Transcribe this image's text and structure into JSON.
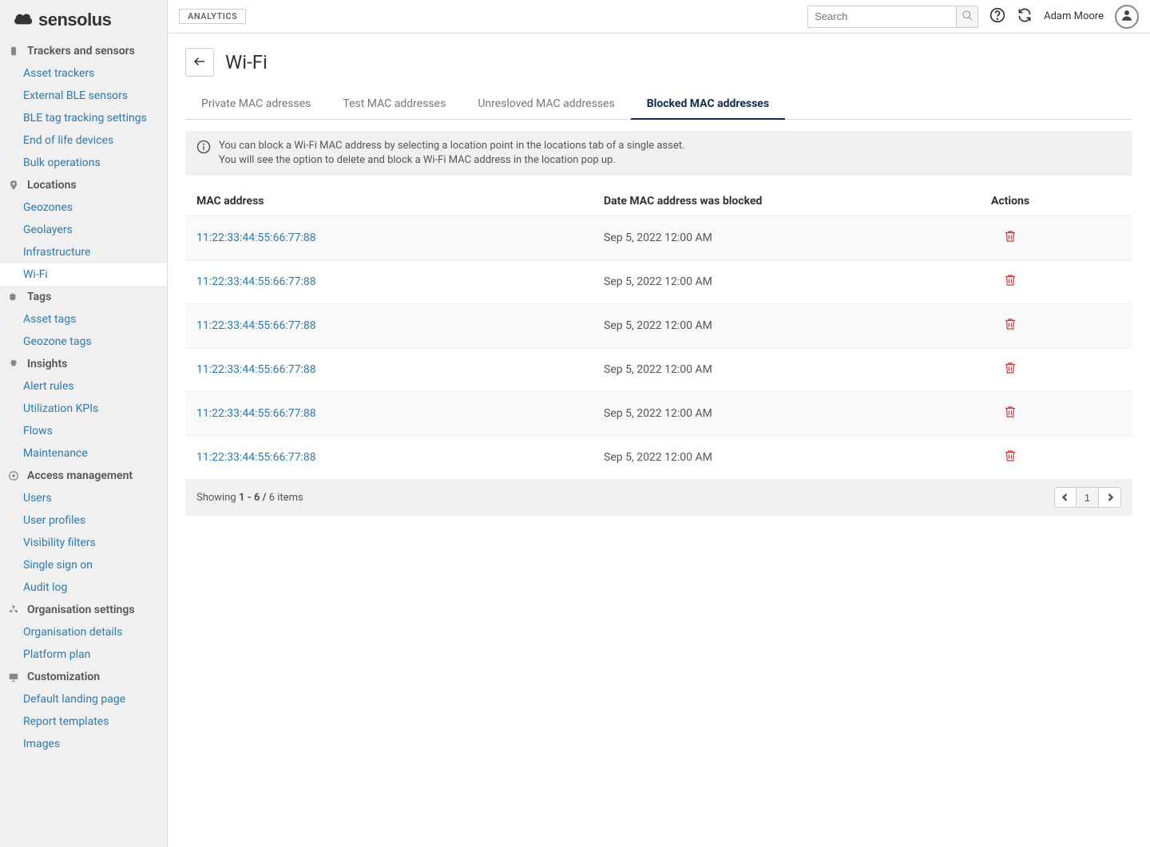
{
  "brand": "sensolus",
  "topbar": {
    "badge": "ANALYTICS",
    "search_placeholder": "Search",
    "username": "Adam Moore"
  },
  "sidebar": {
    "sections": [
      {
        "label": "Trackers and sensors",
        "items": [
          "Asset trackers",
          "External BLE sensors",
          "BLE tag tracking settings",
          "End of life devices",
          "Bulk operations"
        ]
      },
      {
        "label": "Locations",
        "items": [
          "Geozones",
          "Geolayers",
          "Infrastructure",
          "Wi-Fi"
        ]
      },
      {
        "label": "Tags",
        "items": [
          "Asset tags",
          "Geozone tags"
        ]
      },
      {
        "label": "Insights",
        "items": [
          "Alert rules",
          "Utilization KPIs",
          "Flows",
          "Maintenance"
        ]
      },
      {
        "label": "Access management",
        "items": [
          "Users",
          "User profiles",
          "Visibility filters",
          "Single sign on",
          "Audit log"
        ]
      },
      {
        "label": "Organisation settings",
        "items": [
          "Organisation details",
          "Platform plan"
        ]
      },
      {
        "label": "Customization",
        "items": [
          "Default landing page",
          "Report templates",
          "Images"
        ]
      }
    ],
    "active": "Wi-Fi"
  },
  "page": {
    "title": "Wi-Fi",
    "tabs": [
      "Private MAC adresses",
      "Test MAC addresses",
      "Unresloved MAC  addresses",
      "Blocked MAC addresses"
    ],
    "active_tab": "Blocked MAC addresses",
    "info_line1": "You can block a Wi-Fi MAC address by selecting a location point in the locations tab of a single asset.",
    "info_line2": "You will see the option to delete and block a Wi-Fi MAC address in the location pop up.",
    "columns": {
      "mac": "MAC address",
      "date": "Date MAC address was blocked",
      "actions": "Actions"
    },
    "rows": [
      {
        "mac": "11:22:33:44:55:66:77:88",
        "date": "Sep 5, 2022 12:00 AM"
      },
      {
        "mac": "11:22:33:44:55:66:77:88",
        "date": "Sep 5, 2022 12:00 AM"
      },
      {
        "mac": "11:22:33:44:55:66:77:88",
        "date": "Sep 5, 2022 12:00 AM"
      },
      {
        "mac": "11:22:33:44:55:66:77:88",
        "date": "Sep 5, 2022 12:00 AM"
      },
      {
        "mac": "11:22:33:44:55:66:77:88",
        "date": "Sep 5, 2022 12:00 AM"
      },
      {
        "mac": "11:22:33:44:55:66:77:88",
        "date": "Sep 5, 2022 12:00 AM"
      }
    ],
    "footer": {
      "prefix": "Showing ",
      "range": "1 - 6 / ",
      "suffix": "6 items",
      "current_page": "1"
    }
  }
}
